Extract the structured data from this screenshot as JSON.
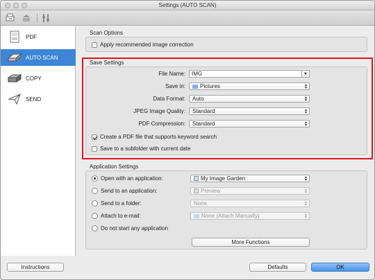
{
  "window": {
    "title": "Settings (AUTO SCAN)"
  },
  "toolbar": {
    "icons": [
      "scan-from-computer-icon",
      "scan-from-operation-panel-icon",
      "general-settings-icon"
    ]
  },
  "sidebar": {
    "items": [
      {
        "label": "PDF",
        "icon": "pdf-icon",
        "active": false
      },
      {
        "label": "AUTO SCAN",
        "icon": "auto-scan-icon",
        "active": true
      },
      {
        "label": "COPY",
        "icon": "copy-icon",
        "active": false
      },
      {
        "label": "SEND",
        "icon": "send-icon",
        "active": false
      }
    ]
  },
  "scan_options": {
    "title": "Scan Options",
    "apply_correction": {
      "label": "Apply recommended image correction",
      "checked": false
    }
  },
  "save_settings": {
    "title": "Save Settings",
    "file_name": {
      "label": "File Name:",
      "value": "IMG"
    },
    "save_in": {
      "label": "Save in:",
      "value": "Pictures"
    },
    "data_format": {
      "label": "Data Format:",
      "value": "Auto"
    },
    "jpeg_quality": {
      "label": "JPEG Image Quality:",
      "value": "Standard"
    },
    "pdf_compression": {
      "label": "PDF Compression:",
      "value": "Standard"
    },
    "keyword_search": {
      "label": "Create a PDF file that supports keyword search",
      "checked": true
    },
    "subfolder": {
      "label": "Save to a subfolder with current date",
      "checked": false
    }
  },
  "application_settings": {
    "title": "Application Settings",
    "open_with": {
      "label": "Open with an application:",
      "value": "My Image Garden",
      "selected": true
    },
    "send_to_app": {
      "label": "Send to an application:",
      "value": "Preview",
      "selected": false
    },
    "send_to_folder": {
      "label": "Send to a folder:",
      "value": "None",
      "selected": false
    },
    "attach_email": {
      "label": "Attach to e-mail:",
      "value": "None (Attach Manually)",
      "selected": false
    },
    "do_not_start": {
      "label": "Do not start any application",
      "selected": false
    },
    "more_functions": "More Functions"
  },
  "footer": {
    "instructions": "Instructions",
    "defaults": "Defaults",
    "ok": "OK"
  },
  "colors": {
    "accent": "#3d85d6",
    "highlight": "#e0141e"
  }
}
